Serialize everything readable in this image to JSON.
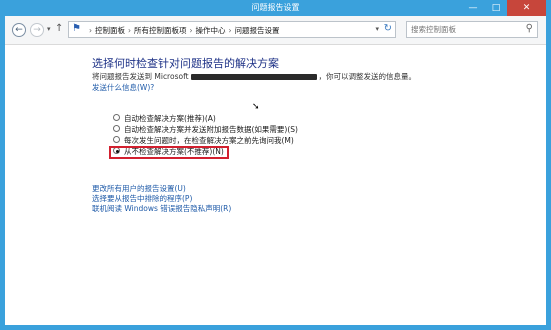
{
  "window": {
    "title": "问题报告设置"
  },
  "nav": {
    "back_icon": "←",
    "forward_icon": "→",
    "dropdown_icon": "▾",
    "up_icon": "↑"
  },
  "address": {
    "flag_icon": "⚑",
    "segments": [
      "控制面板",
      "所有控制面板项",
      "操作中心",
      "问题报告设置"
    ],
    "separator": "›",
    "refresh_icon": "↻"
  },
  "search": {
    "placeholder": "搜索控制面板",
    "icon": "⚲"
  },
  "main": {
    "title": "选择何时检查针对问题报告的解决方案",
    "desc_start": "将问题报告发送到 Microsoft",
    "desc_end": "，你可以调整发送的信息量。",
    "learn_link": "发送什么信息(W)?",
    "options": [
      {
        "label": "自动检查解决方案(推荐)(A)",
        "checked": false
      },
      {
        "label": "自动检查解决方案并发送附加报告数据(如果需要)(S)",
        "checked": false
      },
      {
        "label": "每次发生问题时，在检查解决方案之前先询问我(M)",
        "checked": false
      },
      {
        "label": "从不检查解决方案(不推荐)(N)",
        "checked": true
      }
    ],
    "links": [
      "更改所有用户的报告设置(U)",
      "选择要从报告中排除的程序(P)",
      "联机阅读 Windows 错误报告隐私声明(R)"
    ]
  },
  "colors": {
    "accent": "#3aa1dc",
    "highlight": "#d2202f",
    "link": "#1e5aa8"
  }
}
